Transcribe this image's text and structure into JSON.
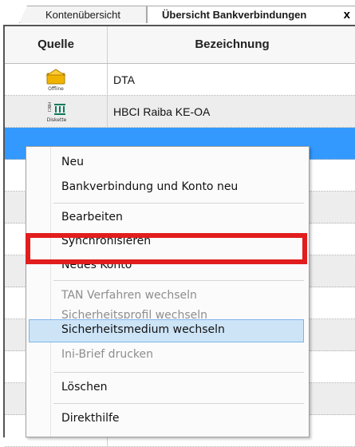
{
  "tabs": [
    {
      "label": "Kontenübersicht"
    },
    {
      "label": "Übersicht Bankverbindungen"
    }
  ],
  "close_glyph": "x",
  "table": {
    "columns": [
      "Quelle",
      "Bezeichnung"
    ],
    "rows": [
      {
        "icon": "offline-icon",
        "icon_caption": "Offline",
        "label": "DTA"
      },
      {
        "icon": "hbci-diskette-icon",
        "icon_caption": "Diskette",
        "icon_side_text": "HBCI",
        "label": "HBCI Raiba KE-OA"
      },
      {
        "label": "",
        "selected": true
      },
      {
        "label": ""
      },
      {
        "label": ""
      },
      {
        "label": ""
      },
      {
        "label": ""
      },
      {
        "label": ""
      },
      {
        "label": ""
      },
      {
        "label": ""
      }
    ]
  },
  "context_menu": {
    "items": [
      {
        "label": "Neu",
        "enabled": true
      },
      {
        "label": "Bankverbindung und Konto neu",
        "enabled": true
      },
      {
        "label": "Bearbeiten",
        "enabled": true
      },
      {
        "label": "Synchronisieren",
        "enabled": true
      },
      {
        "label": "Neues Konto",
        "enabled": true
      },
      {
        "label": "TAN Verfahren wechseln",
        "enabled": false
      },
      {
        "label": "Sicherheitsprofil wechseln",
        "enabled": false
      },
      {
        "label": "Sicherheitsmedium wechseln",
        "enabled": true,
        "highlighted": true
      },
      {
        "label": "Ini-Brief drucken",
        "enabled": false
      },
      {
        "label": "Löschen",
        "enabled": true
      },
      {
        "label": "Direkthilfe",
        "enabled": true
      }
    ]
  },
  "colors": {
    "selection": "#3399ff",
    "menu_highlight": "#cde4f7",
    "annotation_red": "#e11d1d"
  }
}
